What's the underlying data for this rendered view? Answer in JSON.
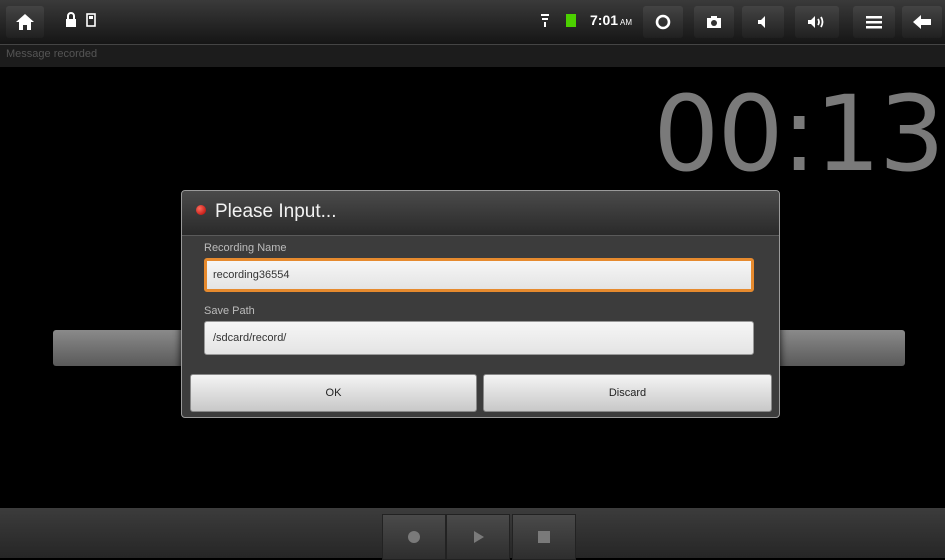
{
  "status_bar": {
    "time": "7:01",
    "ampm": "AM",
    "icons": [
      "home-icon",
      "lock-icon",
      "usb-icon",
      "signal-icon",
      "battery-icon",
      "refresh-icon",
      "camera-icon",
      "volume-down-icon",
      "volume-up-icon",
      "menu-icon",
      "back-icon"
    ]
  },
  "app": {
    "title": "Message recorded",
    "timer": "00:13"
  },
  "dialog": {
    "title": "Please Input...",
    "name_label": "Recording Name",
    "name_value": "recording36554",
    "path_label": "Save Path",
    "path_value": "/sdcard/record/",
    "ok_label": "OK",
    "discard_label": "Discard"
  },
  "controls": {
    "icons": [
      "record-icon",
      "play-icon",
      "stop-icon"
    ]
  },
  "colors": {
    "focus_border": "#e68a2e",
    "battery": "#4cd000",
    "record_dot": "#d00000"
  }
}
